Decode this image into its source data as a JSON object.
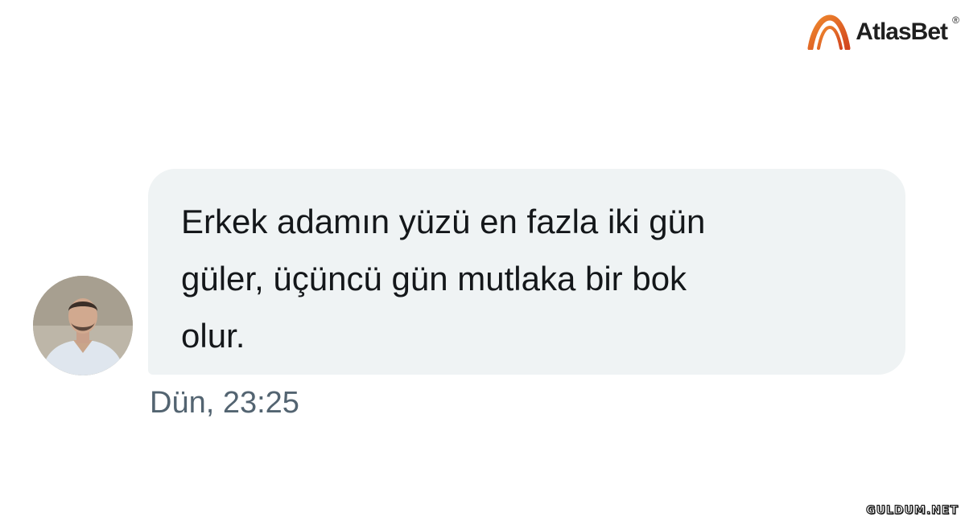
{
  "brand": {
    "name": "AtlasBet",
    "registered_mark": "®",
    "accent_color": "#e2572a"
  },
  "message": {
    "text": "Erkek adamın yüzü en fazla iki gün\ngüler, üçüncü gün mutlaka bir bok\nolur.",
    "timestamp": "Dün, 23:25",
    "bubble_color": "#eff3f4"
  },
  "watermark": {
    "text": "GULDUM.NET"
  }
}
